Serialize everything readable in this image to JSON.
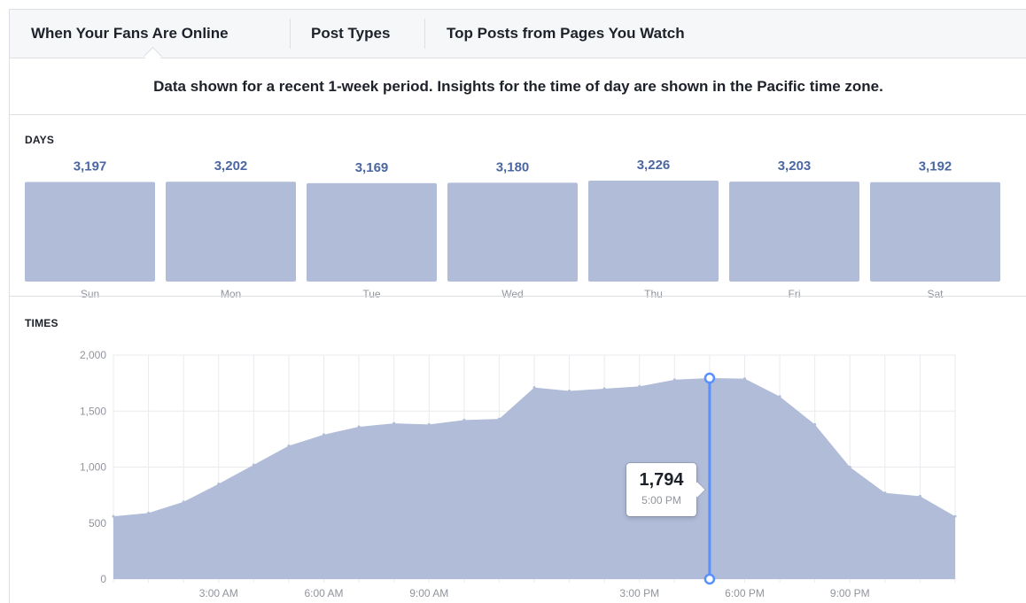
{
  "tabs": [
    {
      "label": "When Your Fans Are Online"
    },
    {
      "label": "Post Types"
    },
    {
      "label": "Top Posts from Pages You Watch"
    }
  ],
  "notice": "Data shown for a recent 1-week period. Insights for the time of day are shown in the Pacific time zone.",
  "days_label": "DAYS",
  "times_label": "TIMES",
  "colors": {
    "bar": "#b0bcd8",
    "area": "#b0bcd8",
    "value_text": "#4b67a1",
    "highlight": "#5890ff",
    "grid": "#e9ebee",
    "axis_text": "#90949c"
  },
  "chart_data": [
    {
      "type": "bar",
      "categories": [
        "Sun",
        "Mon",
        "Tue",
        "Wed",
        "Thu",
        "Fri",
        "Sat"
      ],
      "values": [
        3197,
        3202,
        3169,
        3180,
        3226,
        3203,
        3192
      ],
      "value_labels": [
        "3,197",
        "3,202",
        "3,169",
        "3,180",
        "3,226",
        "3,203",
        "3,192"
      ]
    },
    {
      "type": "area",
      "x_hours": [
        0,
        1,
        2,
        3,
        4,
        5,
        6,
        7,
        8,
        9,
        10,
        11,
        12,
        13,
        14,
        15,
        16,
        17,
        18,
        19,
        20,
        21,
        22,
        23,
        24
      ],
      "values": [
        560,
        590,
        690,
        850,
        1020,
        1190,
        1290,
        1360,
        1390,
        1380,
        1420,
        1430,
        1710,
        1680,
        1700,
        1720,
        1780,
        1794,
        1790,
        1630,
        1380,
        1000,
        770,
        740,
        560
      ],
      "ylim": [
        0,
        2000
      ],
      "yticks": [
        0,
        500,
        1000,
        1500,
        2000
      ],
      "ytick_labels": [
        "0",
        "500",
        "1,000",
        "1,500",
        "2,000"
      ],
      "xticks": [
        {
          "hour": 3,
          "label": "3:00 AM"
        },
        {
          "hour": 6,
          "label": "6:00 AM"
        },
        {
          "hour": 9,
          "label": "9:00 AM"
        },
        {
          "hour": 15,
          "label": "3:00 PM"
        },
        {
          "hour": 18,
          "label": "6:00 PM"
        },
        {
          "hour": 21,
          "label": "9:00 PM"
        }
      ],
      "highlight": {
        "hour": 17,
        "value_label": "1,794",
        "time_label": "5:00 PM"
      }
    }
  ]
}
